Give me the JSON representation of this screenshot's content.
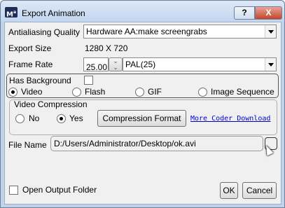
{
  "window": {
    "title": "Export Animation",
    "app_icon_text": "M",
    "app_icon_sup": "a",
    "help_label": "?",
    "close_label": "X"
  },
  "antialiasing": {
    "label": "Antialiasing Quality",
    "value": "Hardware AA:make screengrabs"
  },
  "export_size": {
    "label": "Export Size",
    "value": "1280 X 720"
  },
  "frame_rate": {
    "label": "Frame Rate",
    "value": "25.00",
    "preset": "PAL(25)"
  },
  "background": {
    "label": "Has Background",
    "checked": false
  },
  "format": {
    "options": [
      "Video",
      "Flash",
      "GIF",
      "Image Sequence"
    ],
    "selected": "Video"
  },
  "compression": {
    "group_label": "Video Compression",
    "no_label": "No",
    "yes_label": "Yes",
    "selected": "Yes",
    "format_button": "Compression Format",
    "coder_link": "More Coder Download"
  },
  "file": {
    "label": "File Name",
    "value": "D:/Users/Administrator/Desktop/ok.avi"
  },
  "footer": {
    "open_folder_label": "Open Output Folder",
    "open_folder_checked": false,
    "ok_label": "OK",
    "cancel_label": "Cancel"
  }
}
